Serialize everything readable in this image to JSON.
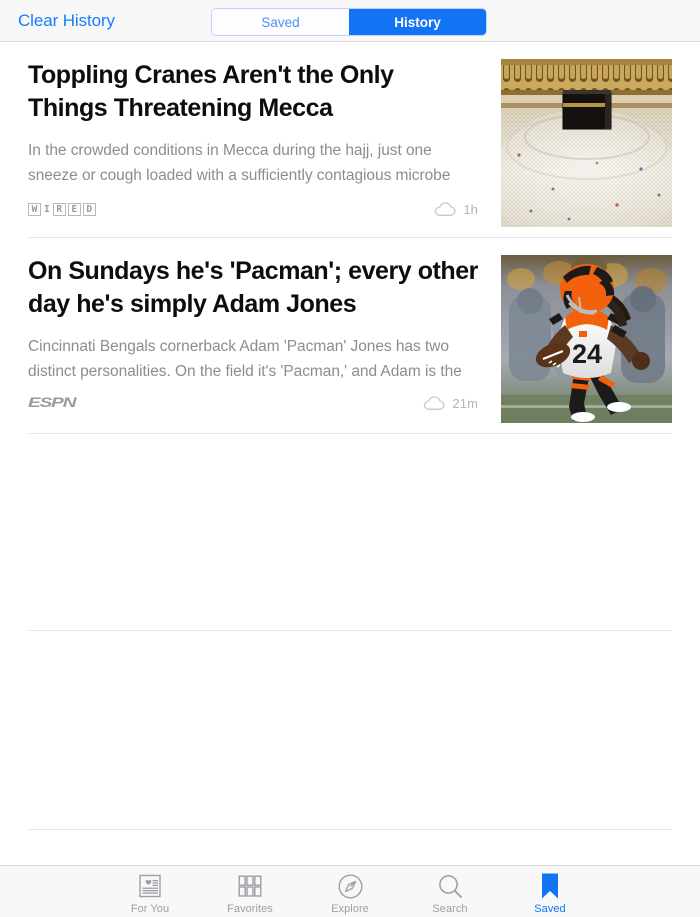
{
  "header": {
    "clear_history_label": "Clear History",
    "segments": [
      {
        "label": "Saved",
        "active": false
      },
      {
        "label": "History",
        "active": true
      }
    ],
    "accent_color": "#167efb",
    "active_segment_bg": "#1373f5"
  },
  "articles": [
    {
      "headline": "Toppling Cranes Aren't the Only Things Threatening Mecca",
      "summary": "In the crowded conditions in Mecca during the hajj, just one sneeze or cough loaded with a sufficiently contagious microbe",
      "publisher": "WIRED",
      "publisher_logo": "wired-logo",
      "time": "1h",
      "status_icon": "cloud-icon",
      "thumbnail_alt": "Crowds of pilgrims surrounding the Kaaba in Mecca"
    },
    {
      "headline": "On Sundays he's 'Pacman'; every other day he's simply Adam Jones",
      "summary": "Cincinnati Bengals cornerback Adam 'Pacman' Jones has two distinct personalities. On the field it's 'Pacman,' and Adam is the",
      "publisher": "ESPN",
      "publisher_logo": "espn-logo",
      "time": "21m",
      "status_icon": "cloud-icon",
      "thumbnail_alt": "Cincinnati Bengals player number 24 running with the football"
    }
  ],
  "tabbar": {
    "tabs": [
      {
        "label": "For You",
        "icon": "article-heart-icon",
        "active": false
      },
      {
        "label": "Favorites",
        "icon": "grid-icon",
        "active": false
      },
      {
        "label": "Explore",
        "icon": "compass-icon",
        "active": false
      },
      {
        "label": "Search",
        "icon": "magnifier-icon",
        "active": false
      },
      {
        "label": "Saved",
        "icon": "bookmark-icon",
        "active": true
      }
    ],
    "active_color": "#1373f5",
    "inactive_color": "#9e9ea4"
  }
}
